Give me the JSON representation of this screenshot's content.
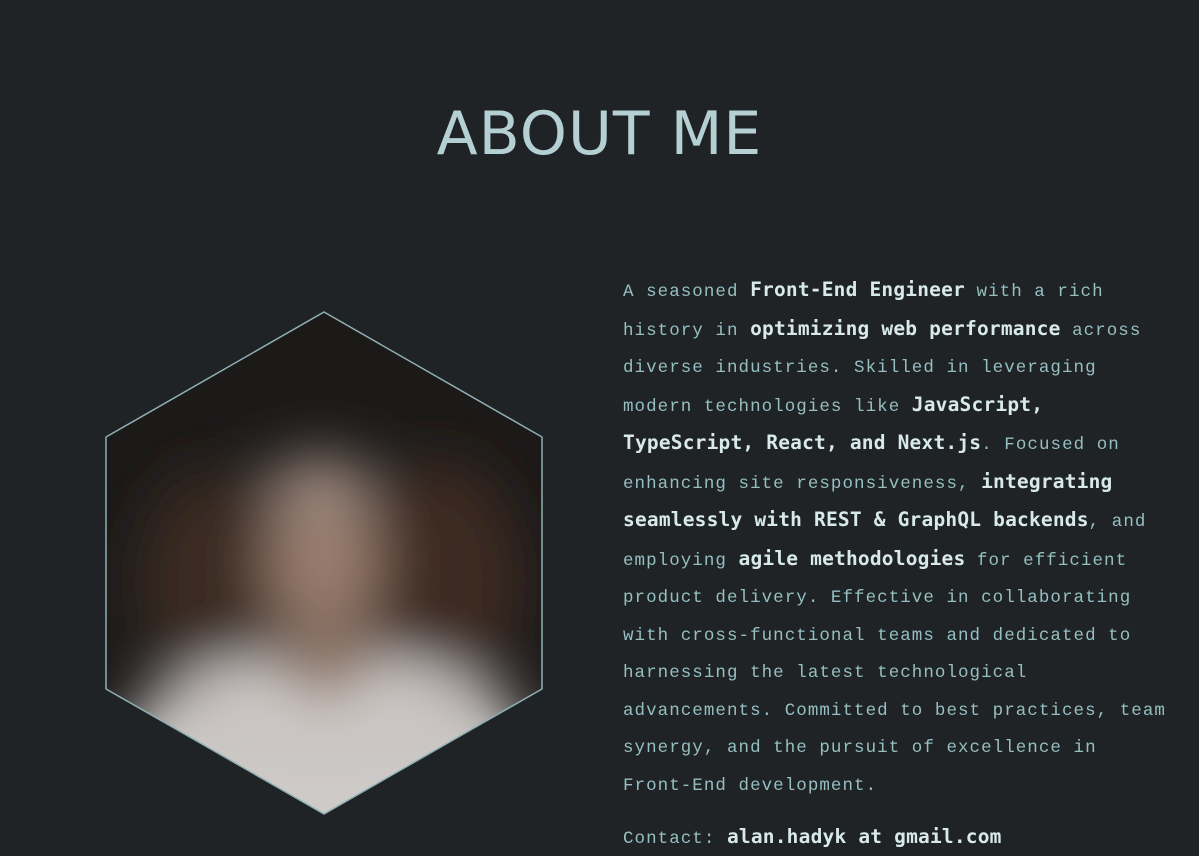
{
  "about": {
    "title": "ABOUT ME",
    "bio": [
      {
        "t": "A seasoned ",
        "b": false
      },
      {
        "t": "Front-End Engineer",
        "b": true
      },
      {
        "t": " with a rich history in ",
        "b": false
      },
      {
        "t": "optimizing web performance",
        "b": true
      },
      {
        "t": " across diverse industries. Skilled in leveraging modern technologies like ",
        "b": false
      },
      {
        "t": "JavaScript, TypeScript, React, and Next.js",
        "b": true
      },
      {
        "t": ". Focused on enhancing site responsiveness, ",
        "b": false
      },
      {
        "t": "integrating seamlessly with REST & GraphQL backends",
        "b": true
      },
      {
        "t": ", and employing ",
        "b": false
      },
      {
        "t": "agile methodologies",
        "b": true
      },
      {
        "t": " for efficient product delivery. Effective in collaborating with cross-functional teams and dedicated to harnessing the latest technological advancements. Committed to best practices, team synergy, and the pursuit of excellence in Front-End development.",
        "b": false
      }
    ],
    "contact_label": "Contact:",
    "contact_value": "alan.hadyk at gmail.com"
  },
  "colors": {
    "background": "#1f2326",
    "heading": "#b4d0d3",
    "body_text": "#95bfc1",
    "emphasis_text": "#d8e9ea",
    "hexagon_border": "#8fb0b3"
  },
  "icons": {
    "portrait": "profile-photo-hexagon"
  }
}
